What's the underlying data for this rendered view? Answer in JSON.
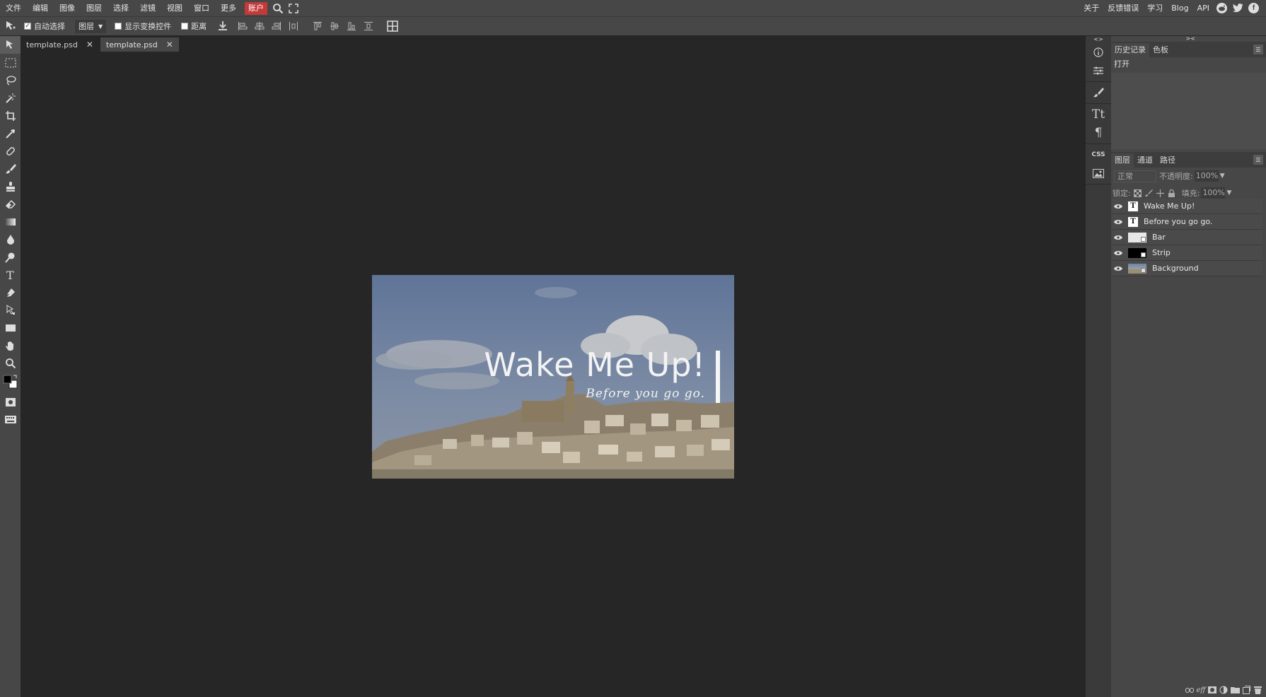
{
  "menu": {
    "items": [
      "文件",
      "编辑",
      "图像",
      "图层",
      "选择",
      "滤镜",
      "视图",
      "窗口",
      "更多"
    ],
    "account": "账户",
    "right_links": [
      "关于",
      "反馈错误",
      "学习",
      "Blog",
      "API"
    ]
  },
  "options": {
    "auto_select_label": "自动选择",
    "auto_select_checked": true,
    "target_select": "图层",
    "show_transform_label": "显示变换控件",
    "distance_label": "距离"
  },
  "tabs": [
    {
      "label": "template.psd",
      "active": false
    },
    {
      "label": "template.psd",
      "active": true
    }
  ],
  "canvas": {
    "title_text": "Wake Me Up!",
    "subtitle_text": "Before you go go."
  },
  "history_panel": {
    "tabs": [
      "历史记录",
      "色板"
    ],
    "entries": [
      "打开"
    ]
  },
  "layers_panel": {
    "tabs": [
      "图层",
      "通道",
      "路径"
    ],
    "blend_mode": "正常",
    "opacity_label": "不透明度:",
    "opacity_value": "100%",
    "lock_label": "锁定:",
    "fill_label": "填充:",
    "fill_value": "100%",
    "layers": [
      {
        "name": "Wake Me Up!",
        "type": "text"
      },
      {
        "name": "Before you go go.",
        "type": "text"
      },
      {
        "name": "Bar",
        "type": "raster"
      },
      {
        "name": "Strip",
        "type": "raster"
      },
      {
        "name": "Background",
        "type": "image"
      }
    ]
  },
  "colors": {
    "menubar_bg": "#474747",
    "workspace_bg": "#262626",
    "account_bg": "#c43a3a",
    "panel_bg": "#474747"
  },
  "icons": {
    "social": [
      "reddit-icon",
      "twitter-icon",
      "facebook-icon"
    ]
  }
}
